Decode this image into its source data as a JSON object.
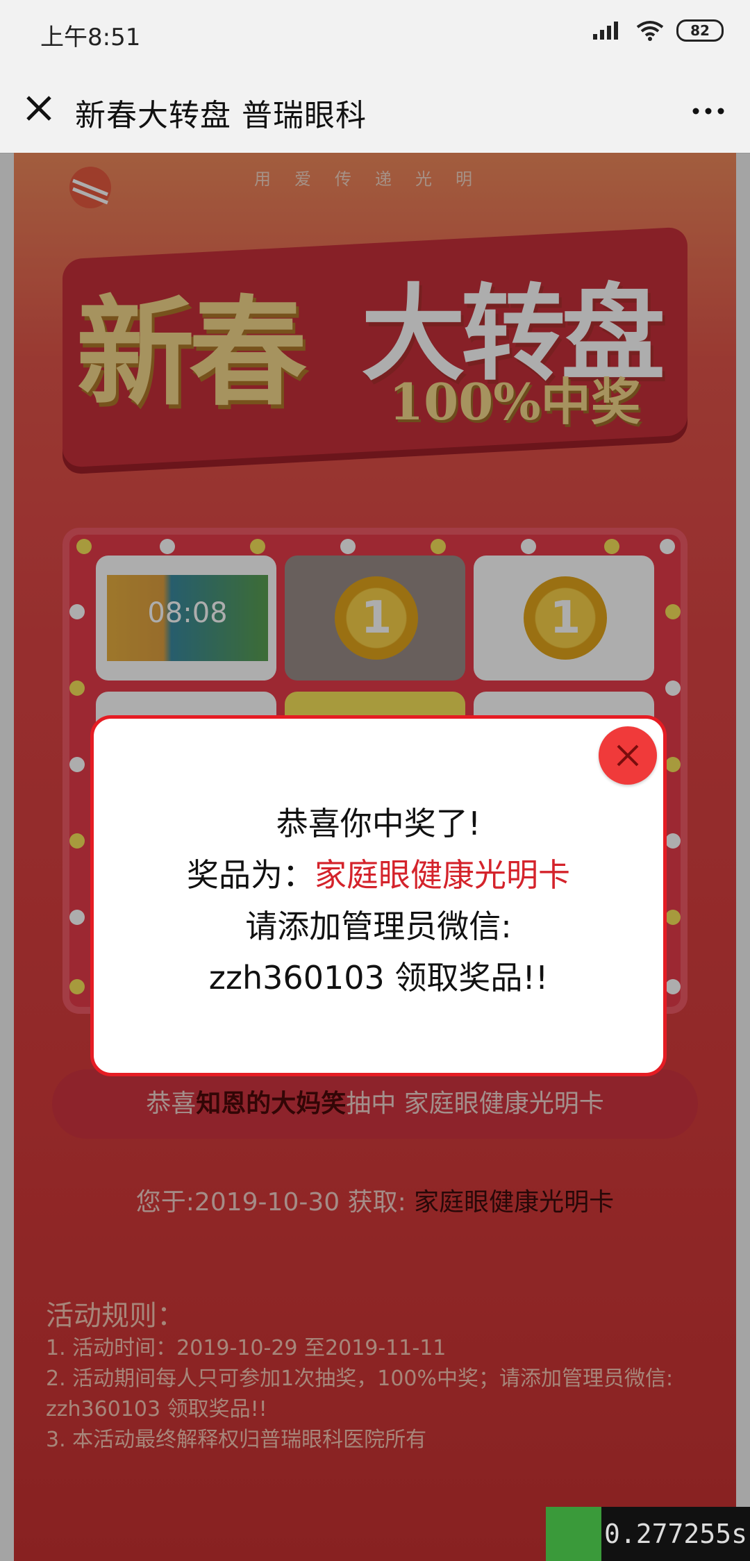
{
  "status": {
    "time": "上午8:51",
    "battery": "82"
  },
  "nav": {
    "title": "新春大转盘 普瑞眼科"
  },
  "banner": {
    "slogan": "用爱传递光明",
    "title_part1": "新春",
    "title_part2": "大转盘",
    "subtitle": "100%中奖"
  },
  "board": {
    "tablet_time": "08:08",
    "medal_number": "1"
  },
  "winner": {
    "prefix": "恭喜",
    "name": "知恩的大妈笑",
    "middle": "抽中 ",
    "prize": "家庭眼健康光明卡"
  },
  "obtained": {
    "label": "您于:2019-10-30 获取: ",
    "prize": "家庭眼健康光明卡"
  },
  "rules": {
    "title": "活动规则：",
    "items": [
      "1. 活动时间：2019-10-29 至2019-11-11",
      "2. 活动期间每人只可参加1次抽奖，100%中奖；请添加管理员微信:",
      "zzh360103 领取奖品!!",
      "3. 本活动最终解释权归普瑞眼科医院所有"
    ]
  },
  "modal": {
    "line1": "恭喜你中奖了!",
    "line2_label": "奖品为：",
    "line2_prize": "家庭眼健康光明卡",
    "line3": "请添加管理员微信:",
    "line4": "zzh360103 领取奖品!!"
  },
  "timer": {
    "value": "0.277255s"
  },
  "colors": {
    "accent": "#e51c23",
    "close_button": "#f03a3a"
  },
  "icons": {
    "close": "close-icon",
    "more": "more-icon",
    "signal": "signal-icon",
    "wifi": "wifi-icon"
  }
}
